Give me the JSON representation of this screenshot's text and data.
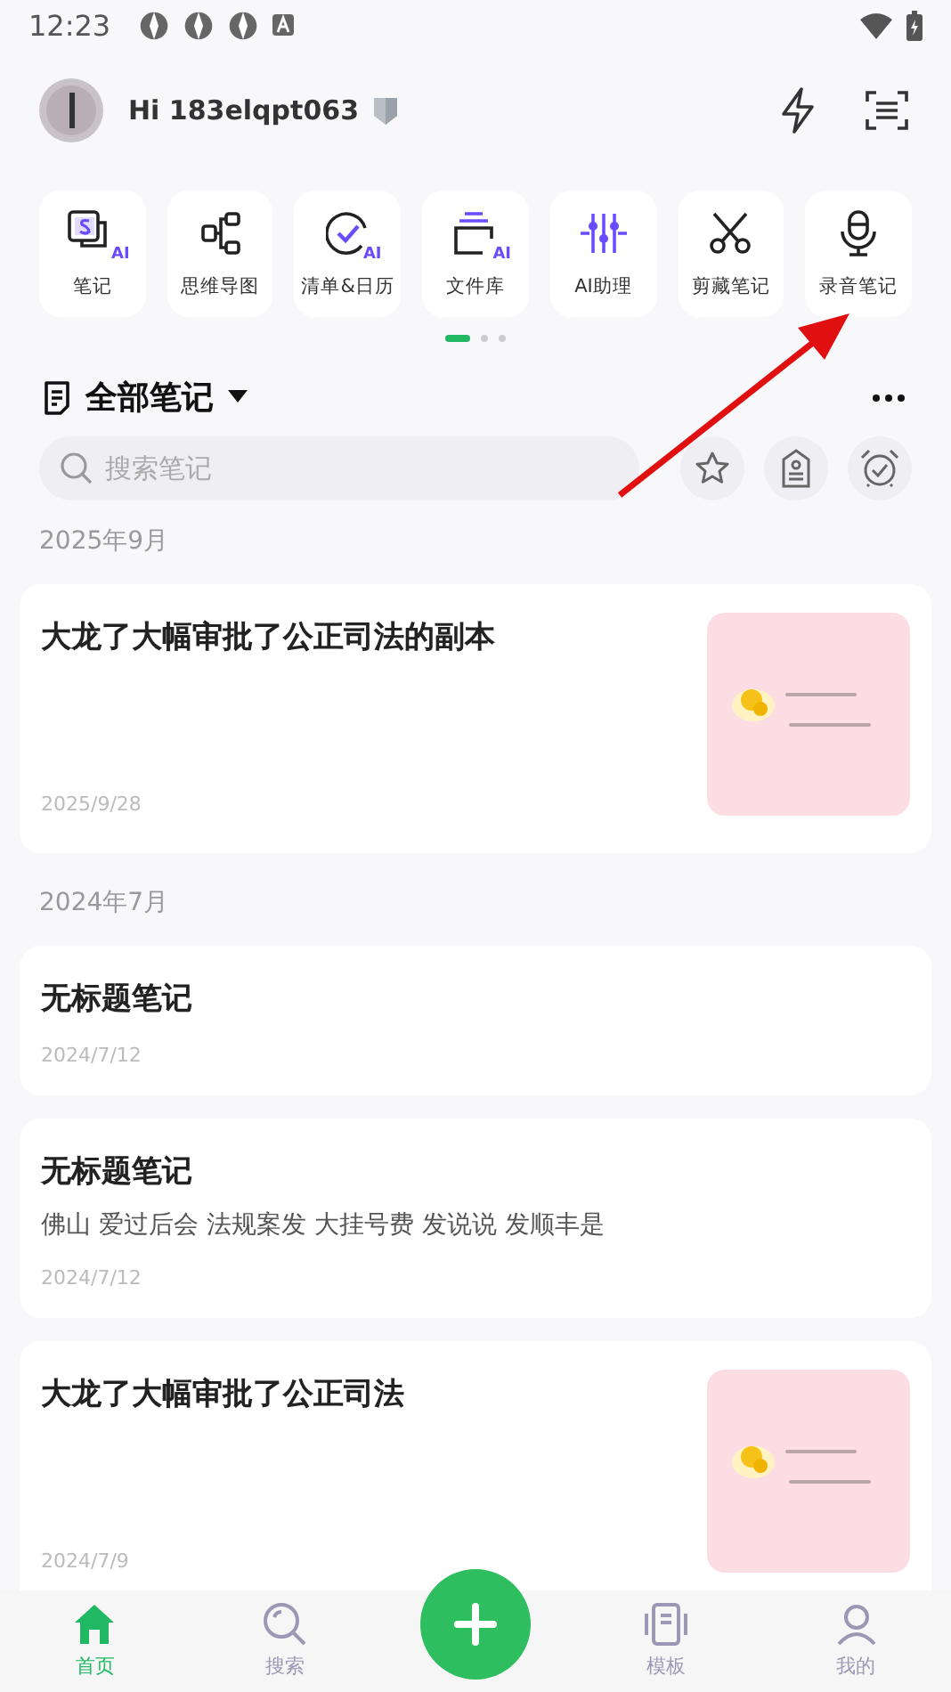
{
  "status_bar": {
    "time": "12:23"
  },
  "header": {
    "greeting": "Hi 183elqpt063"
  },
  "quick_actions": [
    {
      "label": "笔记",
      "kind": "note",
      "badge": "AI"
    },
    {
      "label": "思维导图",
      "kind": "mindmap"
    },
    {
      "label": "清单&日历",
      "kind": "check",
      "badge": "AI"
    },
    {
      "label": "文件库",
      "kind": "files",
      "badge": "AI"
    },
    {
      "label": "AI助理",
      "kind": "assistant"
    },
    {
      "label": "剪藏笔记",
      "kind": "clip"
    },
    {
      "label": "录音笔记",
      "kind": "mic"
    }
  ],
  "pager": [
    {
      "selected": true
    },
    {
      "selected": false
    },
    {
      "selected": false
    }
  ],
  "notes_header": {
    "title": "全部笔记"
  },
  "search": {
    "placeholder": "搜索笔记"
  },
  "sections": [
    {
      "label": "2025年9月",
      "notes": [
        {
          "title": "大龙了大幅审批了公正司法的副本",
          "date": "2025/9/28"
        }
      ]
    },
    {
      "label": "2024年7月",
      "notes": [
        {
          "title": "无标题笔记",
          "date": "2024/7/12"
        },
        {
          "title": "无标题笔记",
          "body": "佛山 爱过后会 法规案发 大挂号费 发说说 发顺丰是",
          "date": "2024/7/12"
        },
        {
          "title": "大龙了大幅审批了公正司法",
          "date": "2024/7/9"
        }
      ]
    }
  ],
  "nav": [
    {
      "label": "首页",
      "kind": "home",
      "selected": true
    },
    {
      "label": "搜索",
      "kind": "search",
      "selected": false
    },
    {
      "kind": "add"
    },
    {
      "label": "模板",
      "kind": "template",
      "selected": false
    },
    {
      "label": "我的",
      "kind": "profile",
      "selected": false
    }
  ]
}
